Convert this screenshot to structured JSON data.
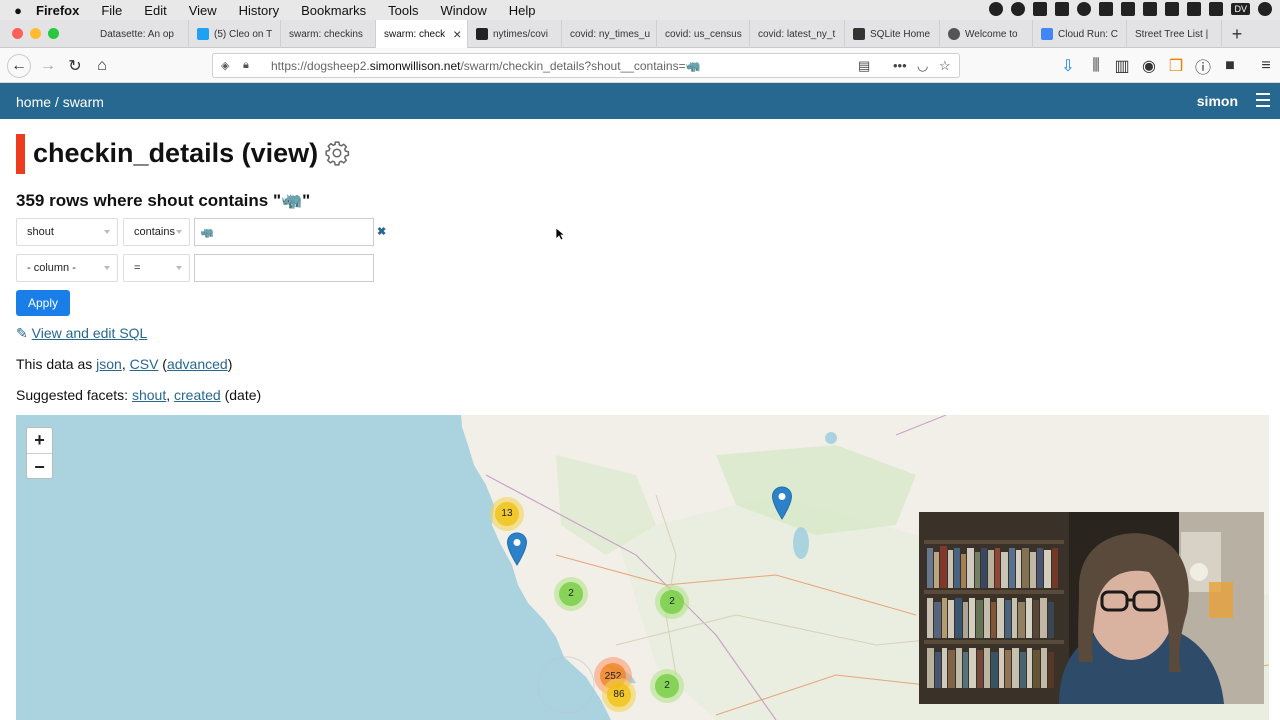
{
  "menubar": {
    "items": [
      "Firefox",
      "File",
      "Edit",
      "View",
      "History",
      "Bookmarks",
      "Tools",
      "Window",
      "Help"
    ],
    "tray_badge": "DV"
  },
  "tabs": [
    {
      "label": "Datasette: An op",
      "active": false
    },
    {
      "label": "(5) Cleo on T",
      "active": false
    },
    {
      "label": "swarm: checkins",
      "active": false
    },
    {
      "label": "swarm: check",
      "active": true
    },
    {
      "label": "nytimes/covi",
      "active": false
    },
    {
      "label": "covid: ny_times_u",
      "active": false
    },
    {
      "label": "covid: us_census",
      "active": false
    },
    {
      "label": "covid: latest_ny_t",
      "active": false
    },
    {
      "label": "SQLite Home",
      "active": false
    },
    {
      "label": "Welcome to",
      "active": false
    },
    {
      "label": "Cloud Run: C",
      "active": false
    },
    {
      "label": "Street Tree List |",
      "active": false
    }
  ],
  "urlbar": {
    "prefix": "https://dogsheep2.",
    "domain": "simonwillison.net",
    "path": "/swarm/checkin_details?shout__contains=🦏"
  },
  "header": {
    "breadcrumb": "home / swarm",
    "user": "simon"
  },
  "page": {
    "title": "checkin_details (view)",
    "row_summary": "359 rows where shout contains \"🦏\""
  },
  "filters": {
    "row1": {
      "column": "shout",
      "op": "contains",
      "value": "🦏"
    },
    "row2": {
      "column": "- column -",
      "op": "=",
      "value": ""
    },
    "clear": "✖",
    "apply_label": "Apply"
  },
  "links": {
    "edit_sql_icon": "✎",
    "edit_sql": "View and edit SQL",
    "data_as_prefix": "This data as",
    "json": "json",
    "csv": "CSV",
    "advanced": "advanced",
    "facets_prefix": "Suggested facets:",
    "facet_shout": "shout",
    "facet_created": "created",
    "facet_created_suffix": "(date)"
  },
  "map": {
    "zoom_in": "+",
    "zoom_out": "−",
    "clusters": [
      {
        "count": "13",
        "color": "yellow"
      },
      {
        "count": "2",
        "color": "green"
      },
      {
        "count": "2",
        "color": "green"
      },
      {
        "count": "252",
        "color": "orange"
      },
      {
        "count": "86",
        "color": "yellow"
      },
      {
        "count": "2",
        "color": "green"
      }
    ]
  },
  "colors": {
    "header": "#276890",
    "accent_bar": "#ee3a1f",
    "apply_button": "#1a7ee8",
    "link": "#276890",
    "water": "#aad3df",
    "land": "#f2efe9"
  }
}
